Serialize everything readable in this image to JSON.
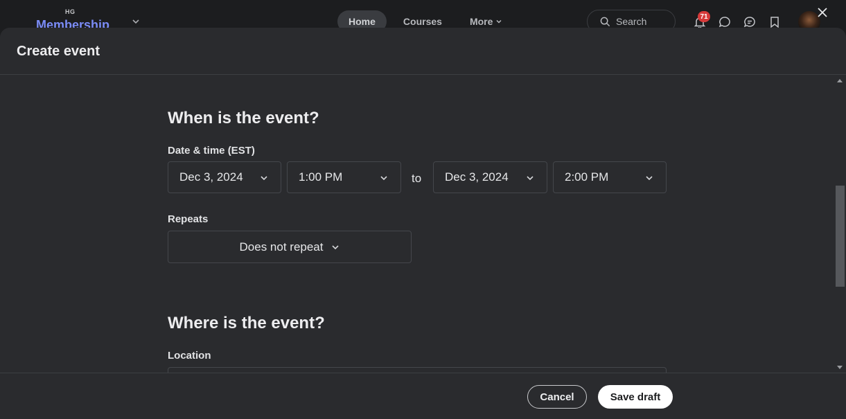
{
  "topbar": {
    "logo_small": "HG",
    "logo_big": "Membership",
    "nav": [
      {
        "label": "Home",
        "active": true
      },
      {
        "label": "Courses",
        "active": false
      },
      {
        "label": "More",
        "active": false
      }
    ],
    "search_placeholder": "Search",
    "notification_count": "71"
  },
  "modal": {
    "title": "Create event",
    "when": {
      "heading": "When is the event?",
      "datetime_label": "Date & time (EST)",
      "start_date": "Dec 3, 2024",
      "start_time": "1:00 PM",
      "to_label": "to",
      "end_date": "Dec 3, 2024",
      "end_time": "2:00 PM",
      "repeats_label": "Repeats",
      "repeats_value": "Does not repeat"
    },
    "where": {
      "heading": "Where is the event?",
      "location_label": "Location"
    },
    "footer": {
      "cancel_label": "Cancel",
      "save_label": "Save draft"
    }
  },
  "colors": {
    "background": "#1c1d1f",
    "modal": "#2a2b2e",
    "badge": "#d63a3a",
    "primary_button": "#ffffff"
  }
}
